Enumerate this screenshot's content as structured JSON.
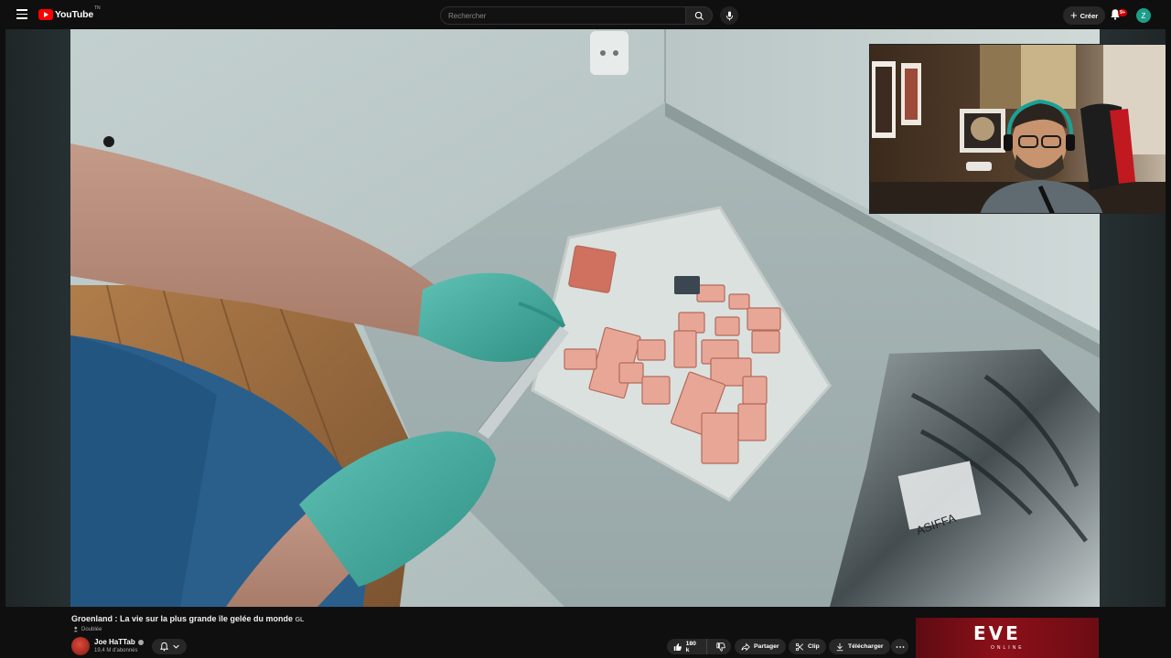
{
  "header": {
    "logo_text": "YouTube",
    "logo_sup": "TN",
    "search_placeholder": "Rechercher",
    "create_label": "Créer",
    "notif_badge": "9+",
    "avatar_letter": "Z"
  },
  "video": {
    "title": "Groenland : La vie sur la plus grande île gelée du monde",
    "title_suffix": "GL",
    "dubbed_label": "Doublée"
  },
  "channel": {
    "name": "Joe HaTTab",
    "subscribers": "19,4 M d'abonnés"
  },
  "actions": {
    "likes": "180 k",
    "share": "Partager",
    "clip": "Clip",
    "download": "Télécharger"
  },
  "ad": {
    "logo": "EVE",
    "sub": "ONLINE"
  },
  "colors": {
    "accent_red": "#ff0000",
    "background": "#0f0f0f",
    "avatar_bg": "#1e9e8a",
    "ad_bg": "#8c1019"
  }
}
